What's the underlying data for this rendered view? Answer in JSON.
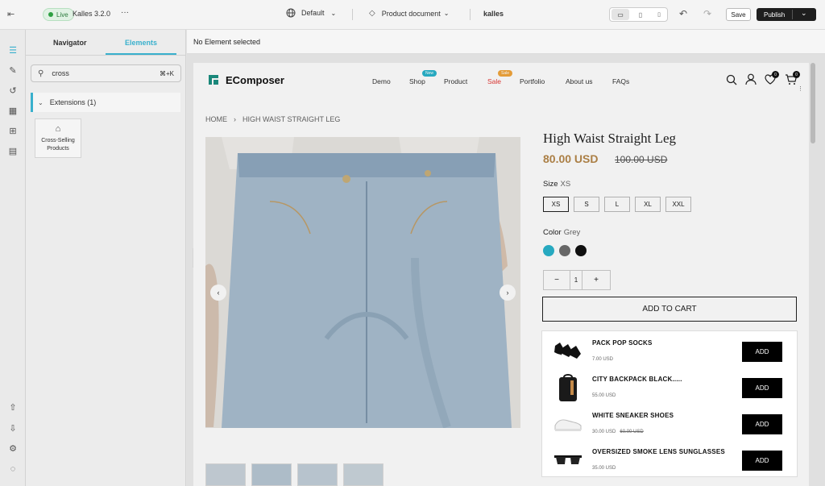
{
  "topbar": {
    "live": "Live",
    "version": "Kalles 3.2.0",
    "more": "···",
    "template": "Default",
    "document": "Product document",
    "store": "kalles",
    "save": "Save",
    "publish": "Publish"
  },
  "sidebar_tabs": {
    "navigator": "Navigator",
    "elements": "Elements"
  },
  "search": {
    "value": "cross",
    "shortcut": "⌘+K"
  },
  "extensions": {
    "label": "Extensions (1)"
  },
  "element_card": {
    "line1": "Cross-Selling",
    "line2": "Products"
  },
  "selection_status": "No Element selected",
  "store_nav": {
    "logo": "EComposer",
    "items": [
      "Demo",
      "Shop",
      "Product",
      "Sale",
      "Portfolio",
      "About us",
      "FAQs"
    ],
    "badges": {
      "shop": "New",
      "sale": "Sale"
    },
    "wishlist_count": "0",
    "cart_count": "0"
  },
  "breadcrumb": {
    "home": "HOME",
    "separator": "›",
    "current": "HIGH WAIST STRAIGHT LEG"
  },
  "product": {
    "title": "High Waist Straight Leg",
    "price": "80.00 USD",
    "compare_price": "100.00 USD",
    "size_label": "Size",
    "size_value": "XS",
    "sizes": [
      "XS",
      "S",
      "L",
      "XL",
      "XXL"
    ],
    "color_label": "Color",
    "color_value": "Grey",
    "swatches": [
      "#2ab3cc",
      "#6e6e6e",
      "#111111"
    ],
    "qty_minus": "−",
    "qty": "1",
    "qty_plus": "+",
    "add_to_cart": "ADD TO CART"
  },
  "cross_sell": [
    {
      "name": "PACK POP SOCKS",
      "price": "7.00 USD",
      "compare": "",
      "button": "ADD",
      "icon": "socks-icon"
    },
    {
      "name": "CITY BACKPACK BLACK.....",
      "price": "55.00 USD",
      "compare": "",
      "button": "ADD",
      "icon": "backpack-icon"
    },
    {
      "name": "WHITE SNEAKER SHOES",
      "price": "30.00 USD",
      "compare": "60.00 USD",
      "button": "ADD",
      "icon": "sneaker-icon"
    },
    {
      "name": "OVERSIZED SMOKE LENS SUNGLASSES",
      "price": "35.00 USD",
      "compare": "",
      "button": "ADD",
      "icon": "sunglasses-icon"
    }
  ],
  "colors": {
    "accent": "#3cb8d6",
    "price": "#b5874a",
    "sale": "#e53935",
    "new_badge": "#2ab3cc",
    "sale_badge": "#f2a63c",
    "logo": "#1c8f82"
  }
}
